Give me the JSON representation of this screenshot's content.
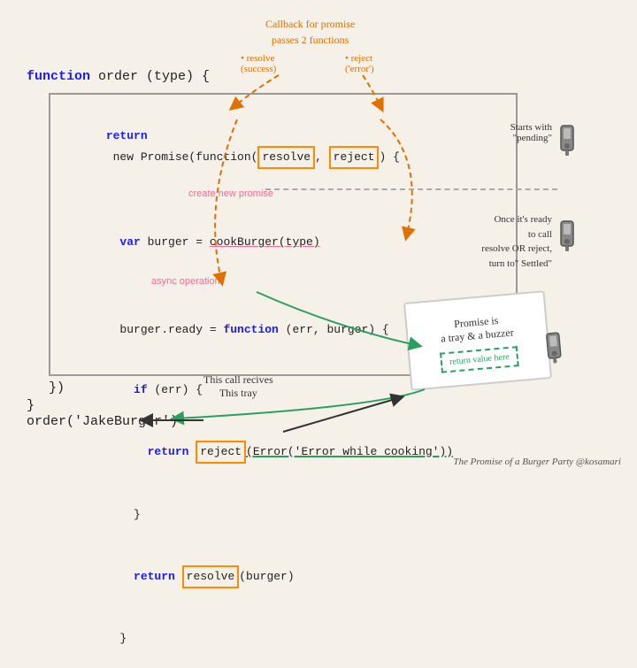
{
  "title": "The Promise of a Burger Party",
  "attribution": "The Promise of a Burger Party @kosamari",
  "code": {
    "func_sig": "function order (type) {",
    "return_line": "return new Promise(function(",
    "resolve_label": "resolve",
    "reject_label": "reject",
    "return_suffix": ") {",
    "var_line": "  var burger = cookBurger(type)",
    "ready_line": "burger.ready = function (err, burger) {",
    "if_line": "  if (err) {",
    "reject_return": "    return ",
    "reject_call": "reject",
    "reject_args": "(Error('Error while cooking'))",
    "close_if": "  }",
    "resolve_return": "  return ",
    "resolve_call": "resolve",
    "resolve_args": "(burger)",
    "close_ready": "}",
    "close_promise_line": "})",
    "close_promise_brace": "}",
    "order_call": "order('JakeBurger')"
  },
  "annotations": {
    "callback_title": "Callback for promise",
    "callback_passes": "passes 2 functions",
    "resolve_ann": "• resolve",
    "resolve_sub": "(success)",
    "reject_ann": "• reject",
    "reject_sub": "('error')",
    "create_promise": "create new promise",
    "async_op": "async operation",
    "this_call": "This call recives",
    "this_tray": "This tray",
    "starts_pending": "Starts with",
    "pending_quote": "\"pending\"",
    "once_ready": "Once it's ready",
    "to_call": "to call",
    "resolve_or_reject": "resolve OR reject,",
    "turn_settled": "turn to\" Settled\"",
    "promise_tray": "Promise is",
    "a_tray": "a tray & a buzzer",
    "return_value": "return value here"
  }
}
